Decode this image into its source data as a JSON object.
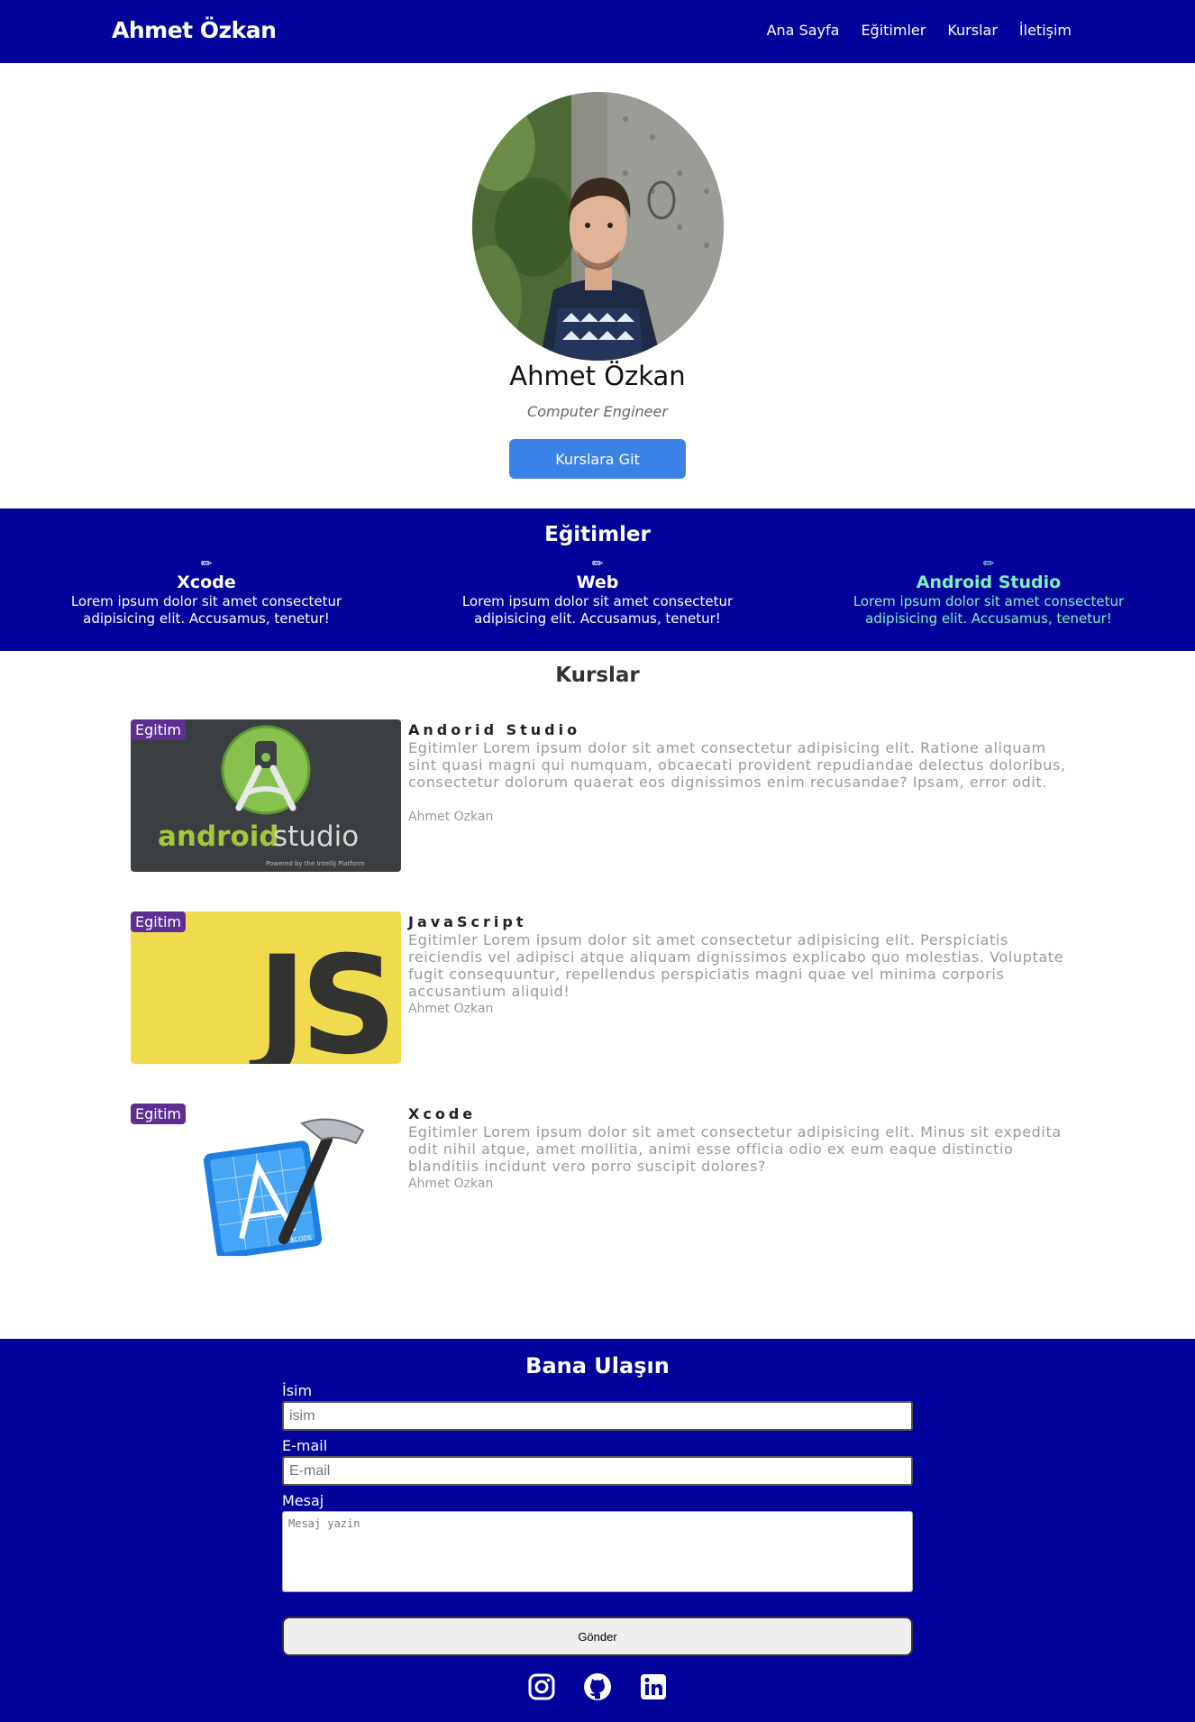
{
  "header": {
    "brand": "Ahmet Özkan",
    "nav": [
      "Ana Sayfa",
      "Eğitimler",
      "Kurslar",
      "İletişim"
    ]
  },
  "hero": {
    "name": "Ahmet Özkan",
    "role": "Computer Engineer",
    "button": "Kurslara Git"
  },
  "education": {
    "title": "Eğitimler",
    "items": [
      {
        "title": "Xcode",
        "text": "Lorem ipsum dolor sit amet consectetur adipisicing elit. Accusamus, tenetur!",
        "icon": "pencil-icon"
      },
      {
        "title": "Web",
        "text": "Lorem ipsum dolor sit amet consectetur adipisicing elit. Accusamus, tenetur!",
        "icon": "pencil-icon"
      },
      {
        "title": "Android Studio",
        "text": "Lorem ipsum dolor sit amet consectetur adipisicing elit. Accusamus, tenetur!",
        "icon": "pencil-icon"
      }
    ],
    "highlight_color": "#7af2c0"
  },
  "courses": {
    "title": "Kurslar",
    "items": [
      {
        "badge": "Egitim",
        "title": "Andorid Studio",
        "desc": "Egitimler Lorem ipsum dolor sit amet consectetur adipisicing elit. Ratione aliquam sint quasi magni qui numquam, obcaecati provident repudiandae delectus doloribus, consectetur dolorum quaerat eos dignissimos enim recusandae? Ipsam, error odit.",
        "author": "Ahmet Ozkan",
        "logo_text": "android",
        "logo_text2": "studio",
        "logo_sub": "Powered by the IntelliJ Platform"
      },
      {
        "badge": "Egitim",
        "title": "JavaScript",
        "desc": "Egitimler Lorem ipsum dolor sit amet consectetur adipisicing elit. Perspiciatis reiciendis vel adipisci atque aliquam dignissimos explicabo quo molestias. Voluptate fugit consequuntur, repellendus perspiciatis magni quae vel minima corporis accusantium aliquid!",
        "author": "Ahmet Ozkan",
        "logo_text": "JS"
      },
      {
        "badge": "Egitim",
        "title": "Xcode",
        "desc": "Egitimler Lorem ipsum dolor sit amet consectetur adipisicing elit. Minus sit expedita odit nihil atque, amet mollitia, animi esse officia odio ex eum eaque distinctio blanditiis incidunt vero porro suscipit dolores?",
        "author": "Ahmet Ozkan",
        "logo_text": "XCODE"
      }
    ]
  },
  "contact": {
    "title": "Bana Ulaşın",
    "name_label": "İsim",
    "name_placeholder": "isim",
    "email_label": "E-mail",
    "email_placeholder": "E-mail",
    "message_label": "Mesaj",
    "message_placeholder": "Mesaj yazin",
    "submit": "Gönder",
    "social": [
      "instagram-icon",
      "github-icon",
      "linkedin-icon"
    ]
  },
  "colors": {
    "primary": "#03039c",
    "button": "#3b82e8",
    "badge": "#5d2f93",
    "js_yellow": "#f0db4f",
    "android_green": "#a4c639"
  }
}
